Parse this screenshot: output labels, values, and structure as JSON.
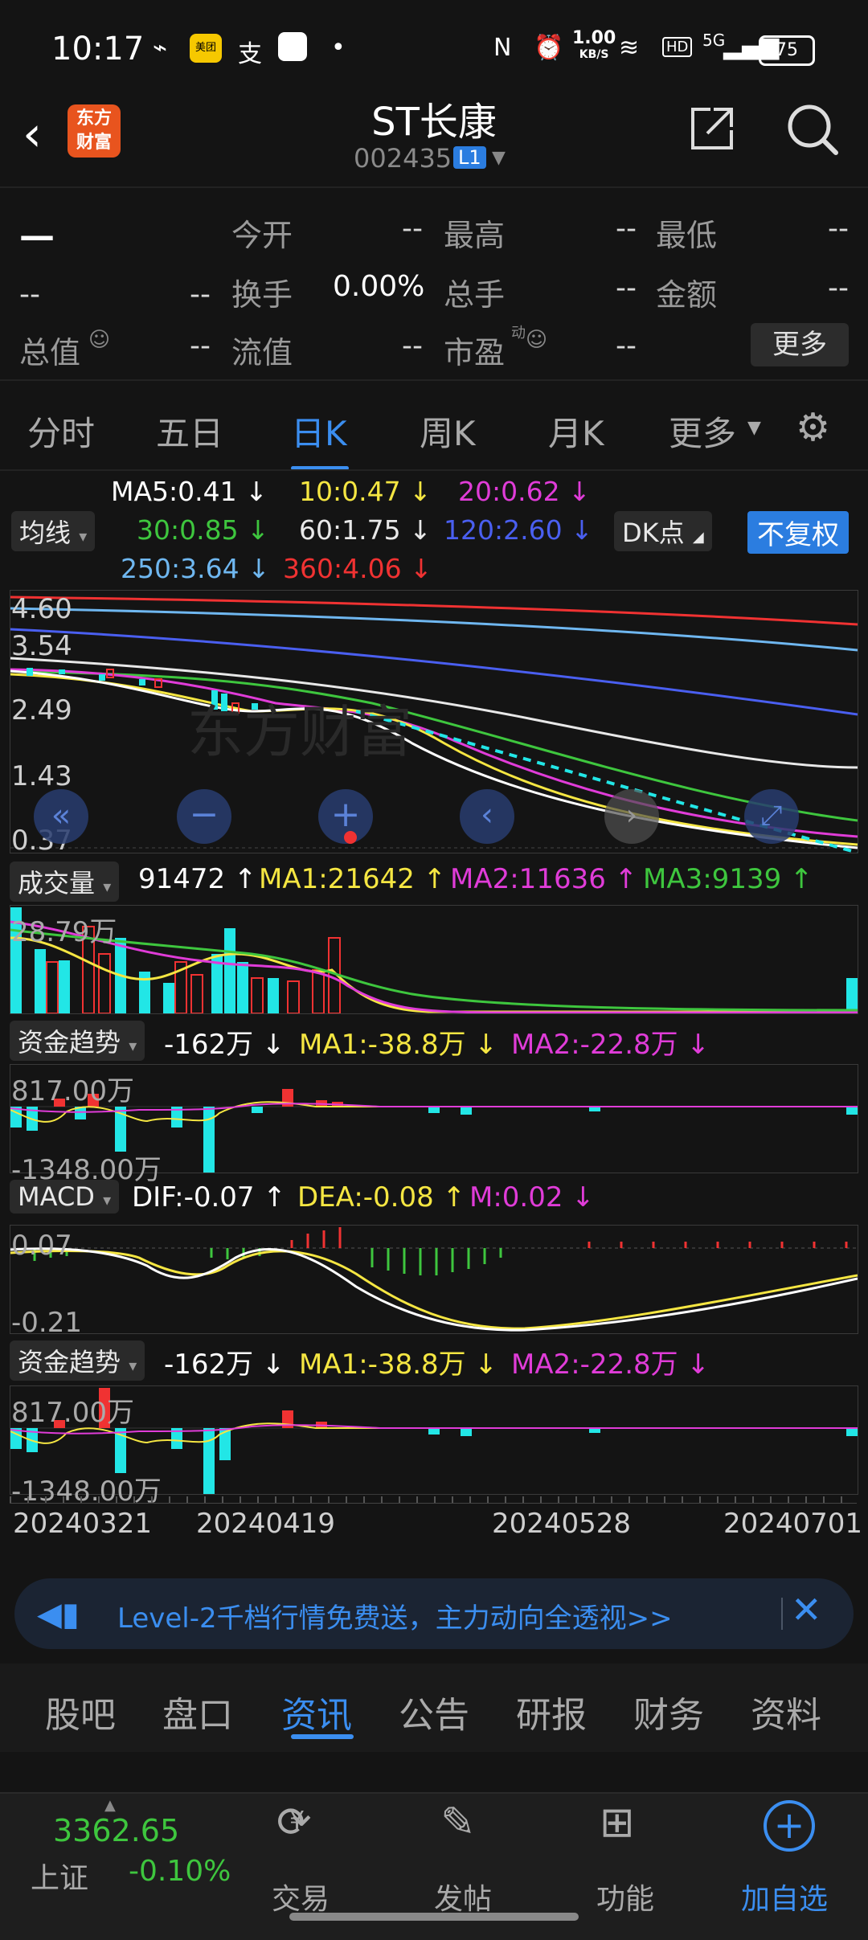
{
  "status_bar": {
    "time": "10:17",
    "net_speed_top": "1.00",
    "net_speed_bottom": "KB/S",
    "battery": "75",
    "signal": "5G",
    "hd": "HD"
  },
  "header": {
    "title": "ST长康",
    "code": "002435",
    "level_badge": "L1",
    "logo_line1": "东方",
    "logo_line2": "财富"
  },
  "quote": {
    "price": "—",
    "change": "--",
    "change_pct": "--",
    "rows": [
      [
        {
          "label": "今开",
          "value": "--"
        },
        {
          "label": "最高",
          "value": "--"
        },
        {
          "label": "最低",
          "value": "--"
        }
      ],
      [
        {
          "label": "换手",
          "value": "0.00%"
        },
        {
          "label": "总手",
          "value": "--"
        },
        {
          "label": "金额",
          "value": "--"
        }
      ],
      [
        {
          "label": "总值",
          "value": "--"
        },
        {
          "label": "流值",
          "value": "--"
        },
        {
          "label": "市盈",
          "value": "--"
        }
      ]
    ],
    "pe_superscript": "动",
    "more": "更多"
  },
  "period_tabs": [
    "分时",
    "五日",
    "日K",
    "周K",
    "月K",
    "更多"
  ],
  "ma_legend": {
    "selector": "均线",
    "items": [
      {
        "text": "MA5:0.41",
        "color": "#ffffff"
      },
      {
        "text": "10:0.47",
        "color": "#f5e642"
      },
      {
        "text": "20:0.62",
        "color": "#e03cd8"
      },
      {
        "text": "30:0.85",
        "color": "#3ec63e"
      },
      {
        "text": "60:1.75",
        "color": "#e8e8e8"
      },
      {
        "text": "120:2.60",
        "color": "#4a5ff0"
      },
      {
        "text": "250:3.64",
        "color": "#6fb7f0"
      },
      {
        "text": "360:4.06",
        "color": "#f03232"
      }
    ],
    "dk": "DK点",
    "fq": "不复权"
  },
  "main_axis": [
    "4.60",
    "3.54",
    "2.49",
    "1.43",
    "0.37"
  ],
  "volume": {
    "selector": "成交量",
    "value": "91472",
    "ma1": "MA1:21642",
    "ma2": "MA2:11636",
    "ma3": "MA3:9139",
    "axis_top": "28.79万"
  },
  "fund1": {
    "selector": "资金趋势",
    "value": "-162万",
    "ma1": "MA1:-38.8万",
    "ma2": "MA2:-22.8万",
    "axis_top": "817.00万",
    "axis_bottom": "-1348.00万"
  },
  "macd": {
    "selector": "MACD",
    "dif": "DIF:-0.07",
    "dea": "DEA:-0.08",
    "m": "M:0.02",
    "axis_top": "0.07",
    "axis_bottom": "-0.21"
  },
  "fund2": {
    "selector": "资金趋势",
    "value": "-162万",
    "ma1": "MA1:-38.8万",
    "ma2": "MA2:-22.8万",
    "axis_top": "817.00万",
    "axis_bottom": "-1348.00万"
  },
  "dates": [
    "20240321",
    "20240419",
    "20240528",
    "20240701"
  ],
  "banner": {
    "text": "Level-2千档行情免费送，主力动向全透视>>"
  },
  "news_tabs": [
    "股吧",
    "盘口",
    "资讯",
    "公告",
    "研报",
    "财务",
    "资料"
  ],
  "bottom_bar": {
    "index_value": "3362.65",
    "index_name": "上证",
    "index_change": "-0.10%",
    "items": [
      {
        "label": "交易",
        "icon": "yuan-icon"
      },
      {
        "label": "发帖",
        "icon": "edit-icon"
      },
      {
        "label": "功能",
        "icon": "grid-icon"
      },
      {
        "label": "加自选",
        "icon": "plus-circle-icon"
      }
    ]
  },
  "colors": {
    "up": "#f03232",
    "down": "#22e6e6",
    "accent": "#3b8ef0",
    "bg": "#141414"
  }
}
